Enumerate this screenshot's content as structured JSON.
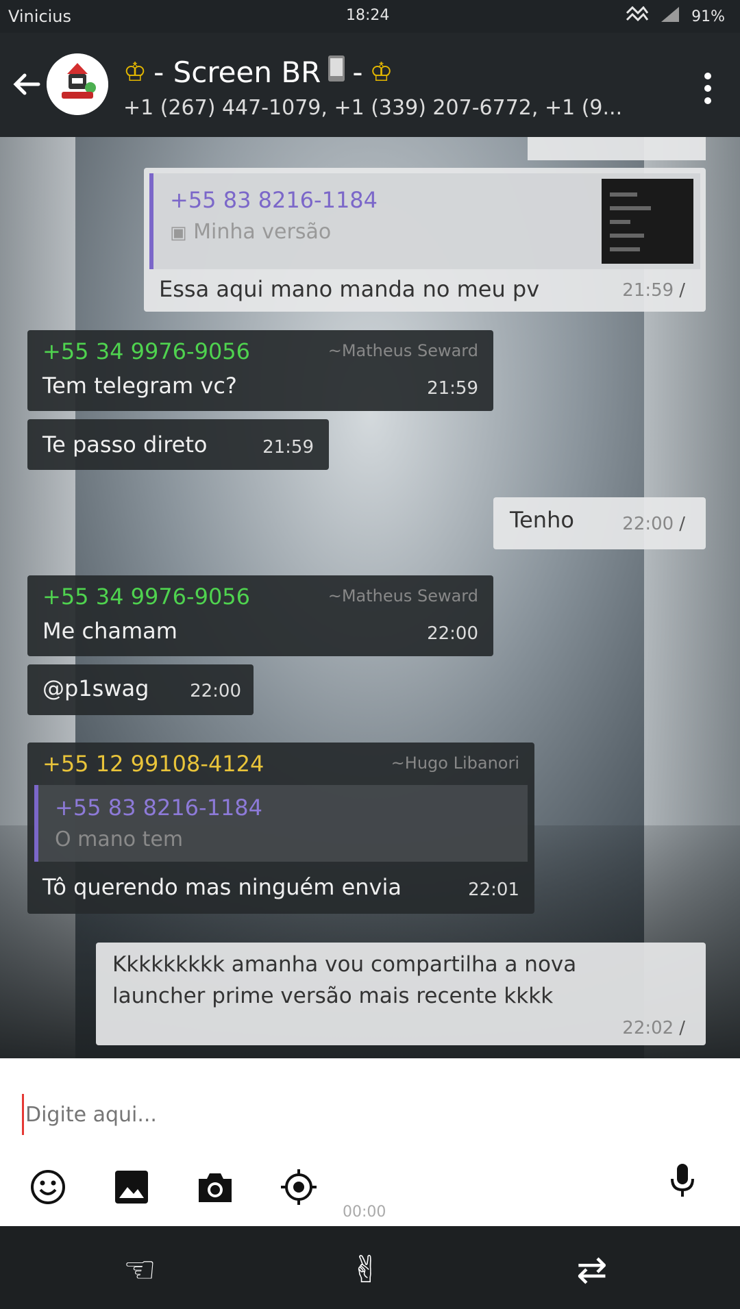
{
  "status_bar": {
    "carrier": "Vinicius",
    "time": "18:24",
    "battery": "91%"
  },
  "header": {
    "title": "- Screen BR",
    "title_end": "-",
    "subtitle": "+1 (267) 447-1079, +1 (339) 207-6772, +1 (9..."
  },
  "messages": [
    {
      "type": "out",
      "quote_number": "+55 83 8216-1184",
      "quote_text": "Minha versão",
      "text": "Essa aqui mano manda no meu pv",
      "time": "21:59"
    },
    {
      "type": "in",
      "sender": "+55 34 9976-9056",
      "alias": "~Matheus Seward",
      "text": "Tem telegram vc?",
      "time": "21:59"
    },
    {
      "type": "in",
      "text": "Te passo direto",
      "time": "21:59"
    },
    {
      "type": "out",
      "text": "Tenho",
      "time": "22:00"
    },
    {
      "type": "in",
      "sender": "+55 34 9976-9056",
      "alias": "~Matheus Seward",
      "text": "Me chamam",
      "time": "22:00"
    },
    {
      "type": "in",
      "text": "@p1swag",
      "time": "22:00"
    },
    {
      "type": "in",
      "sender": "+55 12 99108-4124",
      "alias": "~Hugo Libanori",
      "quote_number": "+55 83 8216-1184",
      "quote_text": "O mano tem",
      "text": "Tô querendo mas ninguém envia",
      "time": "22:01"
    },
    {
      "type": "out",
      "text_line1": "Kkkkkkkkk amanha vou compartilha a nova",
      "text_line2": "launcher prime versão mais recente kkkk",
      "time": "22:02"
    }
  ],
  "composer": {
    "placeholder": "Digite aqui...",
    "recording_time": "00:00"
  },
  "icons": {
    "back": "back-arrow-icon",
    "menu": "more-vert-icon",
    "emoji": "emoji-icon",
    "gallery": "image-icon",
    "camera": "camera-icon",
    "location": "location-icon",
    "mic": "mic-icon"
  },
  "colors": {
    "appbar": "#23272a",
    "incoming_bubble": "#262a2d",
    "outgoing_bubble": "#e6e7e8",
    "sender_green": "#4fd34f",
    "sender_yellow": "#e9c43a",
    "quote_purple": "#7b67c9"
  }
}
